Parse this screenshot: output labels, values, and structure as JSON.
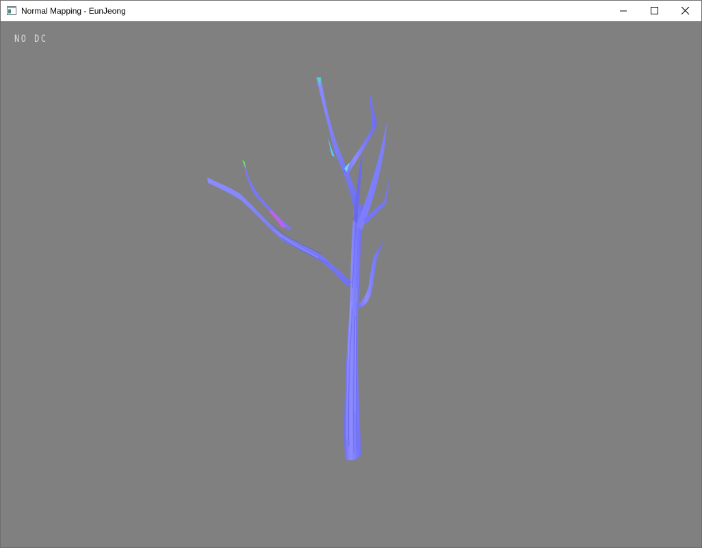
{
  "window": {
    "title": "Normal Mapping - EunJeong",
    "controls": {
      "minimize_icon": "minimize-icon",
      "maximize_icon": "maximize-icon",
      "close_icon": "close-icon"
    }
  },
  "viewport": {
    "overlay_text": "NO DC",
    "background_color": "#808080",
    "object": "tree-model",
    "object_color": "#7f80ff"
  }
}
